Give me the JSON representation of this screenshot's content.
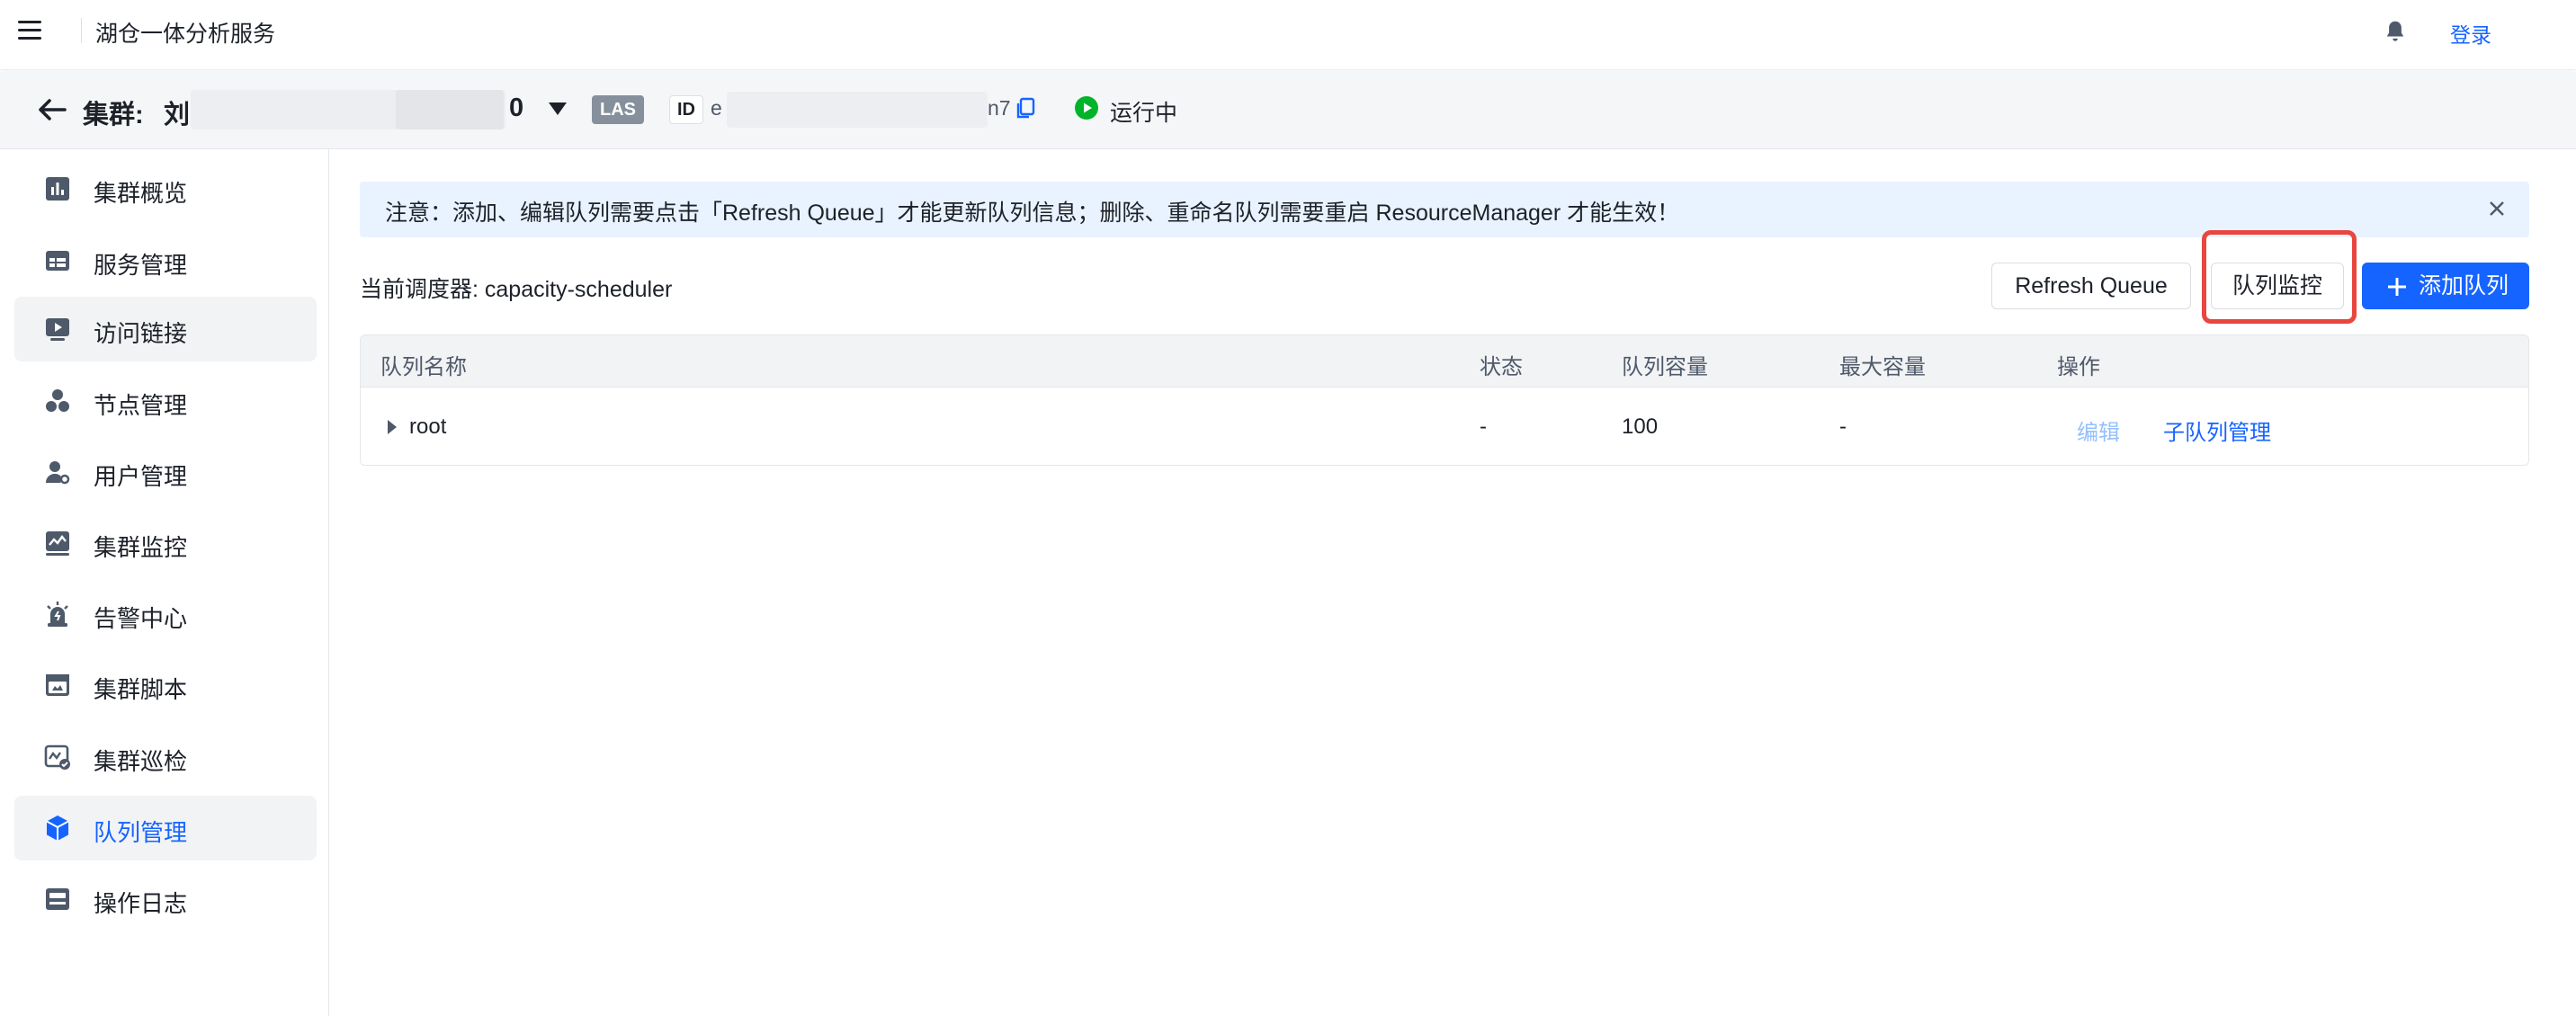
{
  "topbar": {
    "app_title": "湖仓一体分析服务",
    "login_label": "登录"
  },
  "cluster": {
    "label": "集群:",
    "name_prefix": "刘",
    "name_suffix": "0",
    "type_badge": "LAS",
    "id_label": "ID",
    "id_prefix": "e",
    "id_suffix": "n7",
    "status": "运行中"
  },
  "sidebar": {
    "items": [
      {
        "label": "集群概览"
      },
      {
        "label": "服务管理"
      },
      {
        "label": "访问链接"
      },
      {
        "label": "节点管理"
      },
      {
        "label": "用户管理"
      },
      {
        "label": "集群监控"
      },
      {
        "label": "告警中心"
      },
      {
        "label": "集群脚本"
      },
      {
        "label": "集群巡检"
      },
      {
        "label": "队列管理"
      },
      {
        "label": "操作日志"
      }
    ],
    "active": "队列管理"
  },
  "notice": {
    "text": "注意：添加、编辑队列需要点击「Refresh Queue」才能更新队列信息；删除、重命名队列需要重启 ResourceManager 才能生效！"
  },
  "toolbar": {
    "scheduler_text": "当前调度器: capacity-scheduler",
    "refresh_label": "Refresh Queue",
    "monitor_label": "队列监控",
    "add_label": "添加队列"
  },
  "table": {
    "headers": [
      "队列名称",
      "状态",
      "队列容量",
      "最大容量",
      "操作"
    ],
    "rows": [
      {
        "name": "root",
        "status": "-",
        "capacity": "100",
        "max_capacity": "-",
        "action_edit": "编辑",
        "action_sub": "子队列管理"
      }
    ]
  },
  "colors": {
    "primary": "#1664ff",
    "highlight": "#e8463e",
    "running": "#00b42a",
    "notice_bg": "#e8f3ff"
  }
}
